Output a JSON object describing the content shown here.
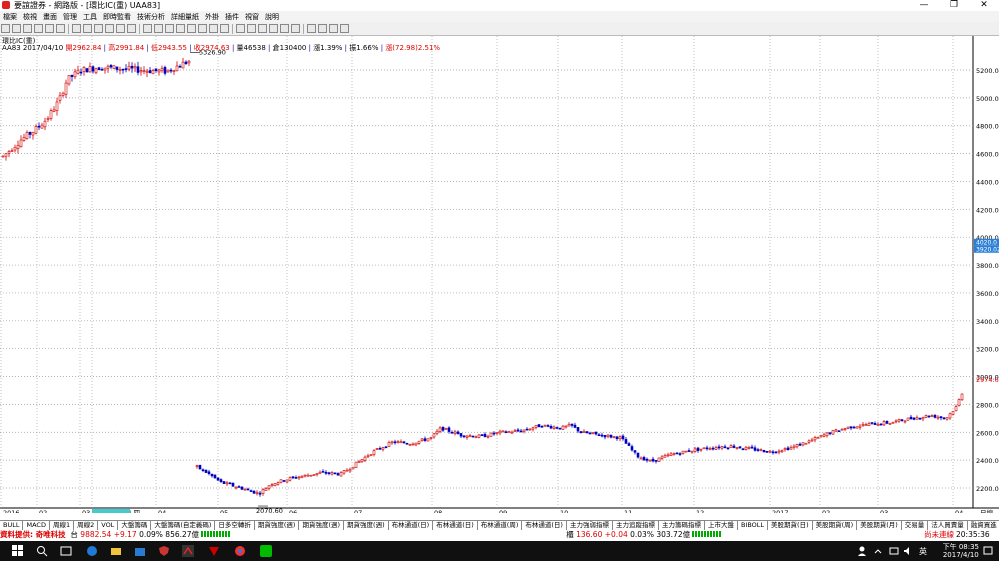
{
  "window": {
    "title": "要誼證券 - 網路版 - [環比IC(重) UAA83]",
    "controls": [
      "—",
      "❐",
      "✕"
    ]
  },
  "menu": [
    "檔案",
    "檢視",
    "畫面",
    "管理",
    "工具",
    "即時監看",
    "技術分析",
    "詳細量紙",
    "外掛",
    "插件",
    "視窗",
    "說明"
  ],
  "info": {
    "line1": "環比IC(重)",
    "line2_prefix": "AA83 2017/04/10 ",
    "open": "開2962.84",
    "high": "高2991.84",
    "low": "低2943.55",
    "close": "收2974.63",
    "volume": "量46538",
    "oi": "倉130400",
    "rise": "漲1.39%",
    "amp": "振1.66%",
    "ma": "漲(72.98)2.51%"
  },
  "chart": {
    "y_ticks": [
      "5200.0",
      "5000.0",
      "4800.0",
      "4600.0",
      "4400.0",
      "4200.0",
      "4000.0",
      "3800.0",
      "3600.0",
      "3400.0",
      "3200.0",
      "3000.0",
      "2800.0",
      "2600.0",
      "2400.0",
      "2200.0"
    ],
    "x_ticks": [
      "2016",
      "02",
      "03",
      "2016/03/24,四",
      "04",
      "05",
      "06",
      "07",
      "08",
      "09",
      "10",
      "11",
      "12",
      "2017",
      "02",
      "03",
      "04"
    ],
    "annotations": {
      "peak": "5326.90",
      "trough": "2070.60"
    },
    "price_box_1": "4020.0",
    "price_box_2": "3920.02",
    "price_box_3": "2974.6",
    "period_label": "日線"
  },
  "bottom_tabs": [
    "BULL",
    "MACD",
    "周線1",
    "周線2",
    "VOL",
    "大盤籌碼",
    "大盤籌碼(自定義碼)",
    "日多空轉折",
    "期貨強度(週)",
    "期貨強度(週)",
    "期貨強度(週)",
    "布林通道(日)",
    "布林通道(日)",
    "布林通道(周)",
    "布林通道(日)",
    "主力強弱指標",
    "主力追蹤指標",
    "主力籌碼指標",
    "上市大盤",
    "BIBOLL",
    "美股期貨(日)",
    "美股期貨(周)",
    "美股期貨(月)",
    "交易量",
    "法人買賣量",
    "融資買進",
    "融券賣出",
    "SII"
  ],
  "ticker": {
    "provider": "資料提供: 奇唯科技",
    "tw_label": "台",
    "tw_value": "9882.54",
    "tw_change": "+9.17",
    "tw_pct": "0.09%",
    "tw_amount": "856.27億",
    "otc_label": "櫃",
    "otc_value": "136.60",
    "otc_change": "+0.04",
    "otc_pct": "0.03%",
    "otc_amount": "303.72億",
    "status": "尚未連線",
    "time": "20:35:36"
  },
  "taskbar": {
    "time": "下午 08:35",
    "date": "2017/4/10",
    "lang": "英"
  },
  "colors": {
    "up": "#d00000",
    "down": "#0000c0",
    "grid": "#999999"
  }
}
